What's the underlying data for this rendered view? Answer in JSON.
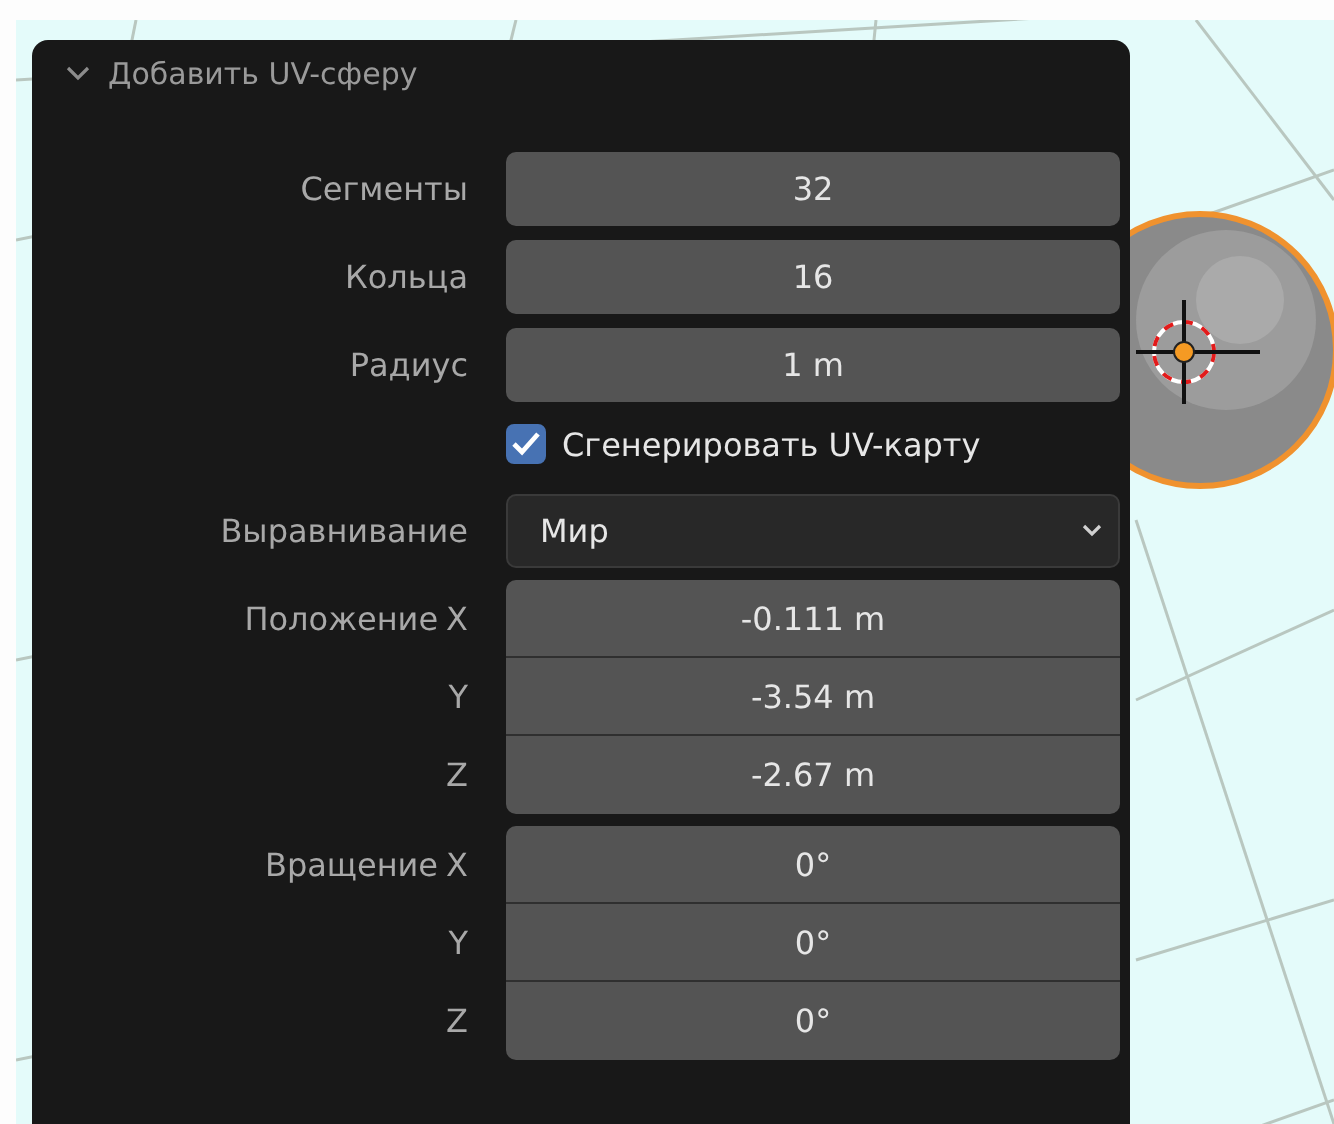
{
  "panel": {
    "title": "Добавить UV-сферу",
    "expanded": true,
    "fields": [
      {
        "kind": "number",
        "label": "Сегменты",
        "value": "32"
      },
      {
        "kind": "number",
        "label": "Кольца",
        "value": "16"
      },
      {
        "kind": "number",
        "label": "Радиус",
        "value": "1 m"
      },
      {
        "kind": "checkbox",
        "label": "Сгенерировать UV-карту",
        "checked": true
      },
      {
        "kind": "dropdown",
        "label": "Выравнивание",
        "value": "Мир"
      },
      {
        "kind": "vector",
        "label": "Положение",
        "axes": [
          {
            "axis": "X",
            "value": "-0.111 m"
          },
          {
            "axis": "Y",
            "value": "-3.54 m"
          },
          {
            "axis": "Z",
            "value": "-2.67 m"
          }
        ]
      },
      {
        "kind": "vector",
        "label": "Вращение",
        "axes": [
          {
            "axis": "X",
            "value": "0°"
          },
          {
            "axis": "Y",
            "value": "0°"
          },
          {
            "axis": "Z",
            "value": "0°"
          }
        ]
      }
    ]
  }
}
